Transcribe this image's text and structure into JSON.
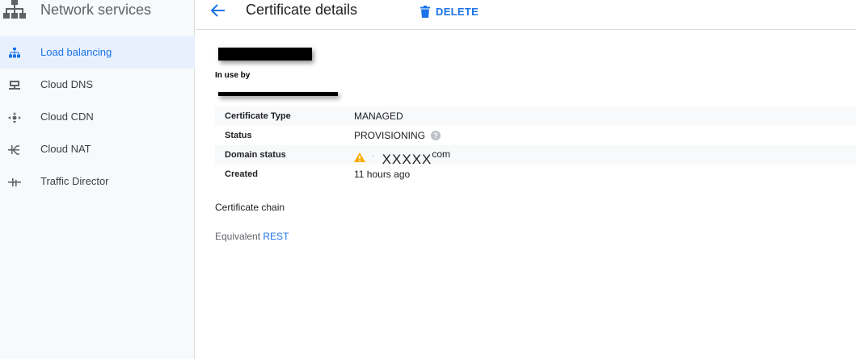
{
  "sidebar": {
    "title": "Network services",
    "items": [
      {
        "label": "Load balancing",
        "icon": "load-balancing-icon",
        "active": true
      },
      {
        "label": "Cloud DNS",
        "icon": "cloud-dns-icon",
        "active": false
      },
      {
        "label": "Cloud CDN",
        "icon": "cloud-cdn-icon",
        "active": false
      },
      {
        "label": "Cloud NAT",
        "icon": "cloud-nat-icon",
        "active": false
      },
      {
        "label": "Traffic Director",
        "icon": "traffic-director-icon",
        "active": false
      }
    ]
  },
  "header": {
    "title": "Certificate details",
    "delete_label": "DELETE"
  },
  "main": {
    "in_use_label": "In use by",
    "details": [
      {
        "label": "Certificate Type",
        "value": "MANAGED"
      },
      {
        "label": "Status",
        "value": "PROVISIONING"
      },
      {
        "label": "Domain status",
        "value_main": "XXXXX",
        "value_suffix": "com"
      },
      {
        "label": "Created",
        "value": "11 hours ago"
      }
    ],
    "certificate_chain": "Certificate chain",
    "equivalent_prefix": "Equivalent",
    "equivalent_link": "REST"
  },
  "colors": {
    "accent": "#1a73e8",
    "active_bg": "#e8f0fe",
    "warning": "#f9ab00",
    "sidebar_bg": "#f8f9fa"
  }
}
